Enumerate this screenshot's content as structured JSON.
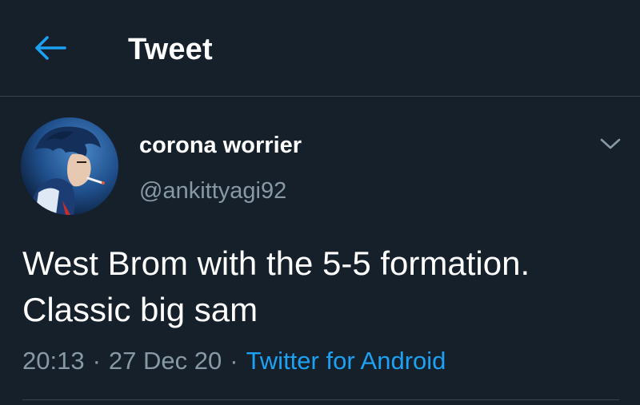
{
  "header": {
    "back_icon": "arrow-left-icon",
    "title": "Tweet"
  },
  "tweet": {
    "author": {
      "display_name": "corona worrier",
      "handle": "@ankittyagi92",
      "avatar_icon": "anime-character-avatar"
    },
    "menu_icon": "chevron-down-icon",
    "text_lines": [
      "West Brom with the 5-5 formation.",
      "Classic big sam"
    ],
    "time": "20:13",
    "date": "27 Dec 20",
    "separator": "·",
    "source": "Twitter for Android"
  },
  "colors": {
    "background": "#15202b",
    "accent": "#1da1f2",
    "secondary_text": "#8899a6",
    "divider": "#38444d"
  }
}
